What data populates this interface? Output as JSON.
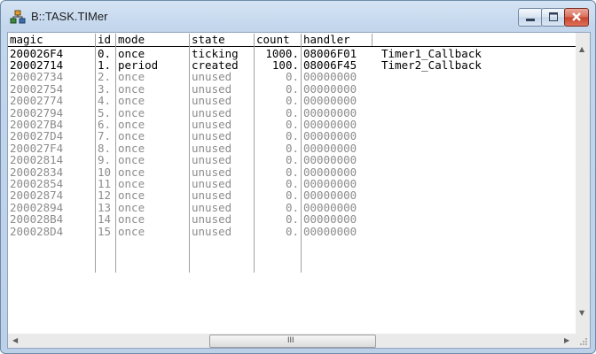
{
  "window": {
    "title": "B::TASK.TIMer"
  },
  "table": {
    "columns": [
      "magic",
      "id",
      "mode",
      "state",
      "count",
      "handler"
    ],
    "rows": [
      {
        "magic": "200026F4",
        "id": "0.",
        "mode": "once",
        "state": "ticking",
        "count": "1000.",
        "handler": "08006F01",
        "callback": "Timer1_Callback",
        "active": true
      },
      {
        "magic": "20002714",
        "id": "1.",
        "mode": "period",
        "state": "created",
        "count": "100.",
        "handler": "08006F45",
        "callback": "Timer2_Callback",
        "active": true
      },
      {
        "magic": "20002734",
        "id": "2.",
        "mode": "once",
        "state": "unused",
        "count": "0.",
        "handler": "00000000",
        "callback": "",
        "active": false
      },
      {
        "magic": "20002754",
        "id": "3.",
        "mode": "once",
        "state": "unused",
        "count": "0.",
        "handler": "00000000",
        "callback": "",
        "active": false
      },
      {
        "magic": "20002774",
        "id": "4.",
        "mode": "once",
        "state": "unused",
        "count": "0.",
        "handler": "00000000",
        "callback": "",
        "active": false
      },
      {
        "magic": "20002794",
        "id": "5.",
        "mode": "once",
        "state": "unused",
        "count": "0.",
        "handler": "00000000",
        "callback": "",
        "active": false
      },
      {
        "magic": "200027B4",
        "id": "6.",
        "mode": "once",
        "state": "unused",
        "count": "0.",
        "handler": "00000000",
        "callback": "",
        "active": false
      },
      {
        "magic": "200027D4",
        "id": "7.",
        "mode": "once",
        "state": "unused",
        "count": "0.",
        "handler": "00000000",
        "callback": "",
        "active": false
      },
      {
        "magic": "200027F4",
        "id": "8.",
        "mode": "once",
        "state": "unused",
        "count": "0.",
        "handler": "00000000",
        "callback": "",
        "active": false
      },
      {
        "magic": "20002814",
        "id": "9.",
        "mode": "once",
        "state": "unused",
        "count": "0.",
        "handler": "00000000",
        "callback": "",
        "active": false
      },
      {
        "magic": "20002834",
        "id": "10",
        "mode": "once",
        "state": "unused",
        "count": "0.",
        "handler": "00000000",
        "callback": "",
        "active": false
      },
      {
        "magic": "20002854",
        "id": "11",
        "mode": "once",
        "state": "unused",
        "count": "0.",
        "handler": "00000000",
        "callback": "",
        "active": false
      },
      {
        "magic": "20002874",
        "id": "12",
        "mode": "once",
        "state": "unused",
        "count": "0.",
        "handler": "00000000",
        "callback": "",
        "active": false
      },
      {
        "magic": "20002894",
        "id": "13",
        "mode": "once",
        "state": "unused",
        "count": "0.",
        "handler": "00000000",
        "callback": "",
        "active": false
      },
      {
        "magic": "200028B4",
        "id": "14",
        "mode": "once",
        "state": "unused",
        "count": "0.",
        "handler": "00000000",
        "callback": "",
        "active": false
      },
      {
        "magic": "200028D4",
        "id": "15",
        "mode": "once",
        "state": "unused",
        "count": "0.",
        "handler": "00000000",
        "callback": "",
        "active": false
      }
    ]
  },
  "icons": {
    "app": "task-window-icon",
    "minimize": "minimize-icon",
    "maximize": "maximize-icon",
    "close": "close-icon",
    "scroll_up": "scroll-up-arrow-icon",
    "scroll_down": "scroll-down-arrow-icon",
    "scroll_left": "scroll-left-arrow-icon",
    "scroll_right": "scroll-right-arrow-icon"
  },
  "hscroll_thumb_grip": "III",
  "colors": {
    "active_text": "#000000",
    "inactive_text": "#8c8c8c",
    "close_button": "#c7432c"
  }
}
